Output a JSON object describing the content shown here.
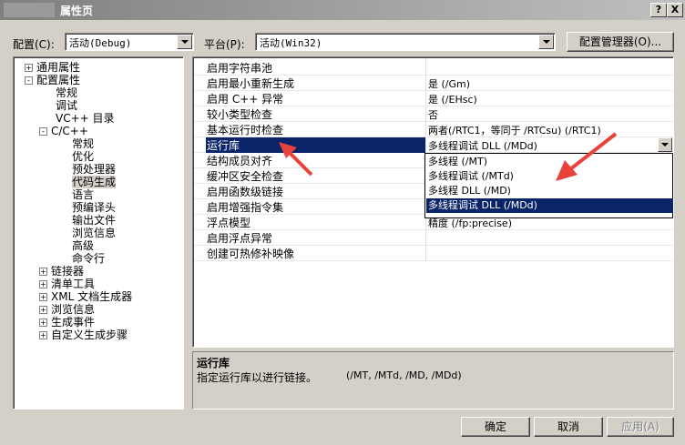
{
  "window": {
    "title": "属性页",
    "help_btn": "?",
    "close_btn": "X"
  },
  "config": {
    "label": "配置(C):",
    "value": "活动(Debug)"
  },
  "platform": {
    "label": "平台(P):",
    "value": "活动(Win32)"
  },
  "config_manager_btn": "配置管理器(O)...",
  "tree": [
    {
      "label": "通用属性",
      "toggle": "+"
    },
    {
      "label": "配置属性",
      "toggle": "-"
    },
    {
      "label": "常规"
    },
    {
      "label": "调试"
    },
    {
      "label": "VC++ 目录"
    },
    {
      "label": "C/C++",
      "toggle": "-"
    },
    {
      "label": "常规"
    },
    {
      "label": "优化"
    },
    {
      "label": "预处理器"
    },
    {
      "label": "代码生成"
    },
    {
      "label": "语言"
    },
    {
      "label": "预编译头"
    },
    {
      "label": "输出文件"
    },
    {
      "label": "浏览信息"
    },
    {
      "label": "高级"
    },
    {
      "label": "命令行"
    },
    {
      "label": "链接器",
      "toggle": "+"
    },
    {
      "label": "清单工具",
      "toggle": "+"
    },
    {
      "label": "XML 文档生成器",
      "toggle": "+"
    },
    {
      "label": "浏览信息",
      "toggle": "+"
    },
    {
      "label": "生成事件",
      "toggle": "+"
    },
    {
      "label": "自定义生成步骤",
      "toggle": "+"
    }
  ],
  "grid": [
    {
      "name": "启用字符串池",
      "value": ""
    },
    {
      "name": "启用最小重新生成",
      "value": "是 (/Gm)"
    },
    {
      "name": "启用 C++ 异常",
      "value": "是 (/EHsc)"
    },
    {
      "name": "较小类型检查",
      "value": "否"
    },
    {
      "name": "基本运行时检查",
      "value": "两者(/RTC1，等同于 /RTCsu) (/RTC1)"
    },
    {
      "name": "运行库",
      "value": "多线程调试 DLL (/MDd)"
    },
    {
      "name": "结构成员对齐",
      "value": ""
    },
    {
      "name": "缓冲区安全检查",
      "value": ""
    },
    {
      "name": "启用函数级链接",
      "value": ""
    },
    {
      "name": "启用增强指令集",
      "value": ""
    },
    {
      "name": "浮点模型",
      "value": "精度 (/fp:precise)"
    },
    {
      "name": "启用浮点异常",
      "value": ""
    },
    {
      "name": "创建可热修补映像",
      "value": ""
    }
  ],
  "dropdown": [
    "多线程 (/MT)",
    "多线程调试 (/MTd)",
    "多线程 DLL (/MD)",
    "多线程调试 DLL (/MDd)"
  ],
  "description": {
    "title": "运行库",
    "text": "指定运行库以进行链接。",
    "options": "(/MT, /MTd, /MD, /MDd)"
  },
  "buttons": {
    "ok": "确定",
    "cancel": "取消",
    "apply": "应用(A)"
  },
  "colors": {
    "selection": "#0a246a",
    "annotation_arrow": "#e8423c"
  }
}
